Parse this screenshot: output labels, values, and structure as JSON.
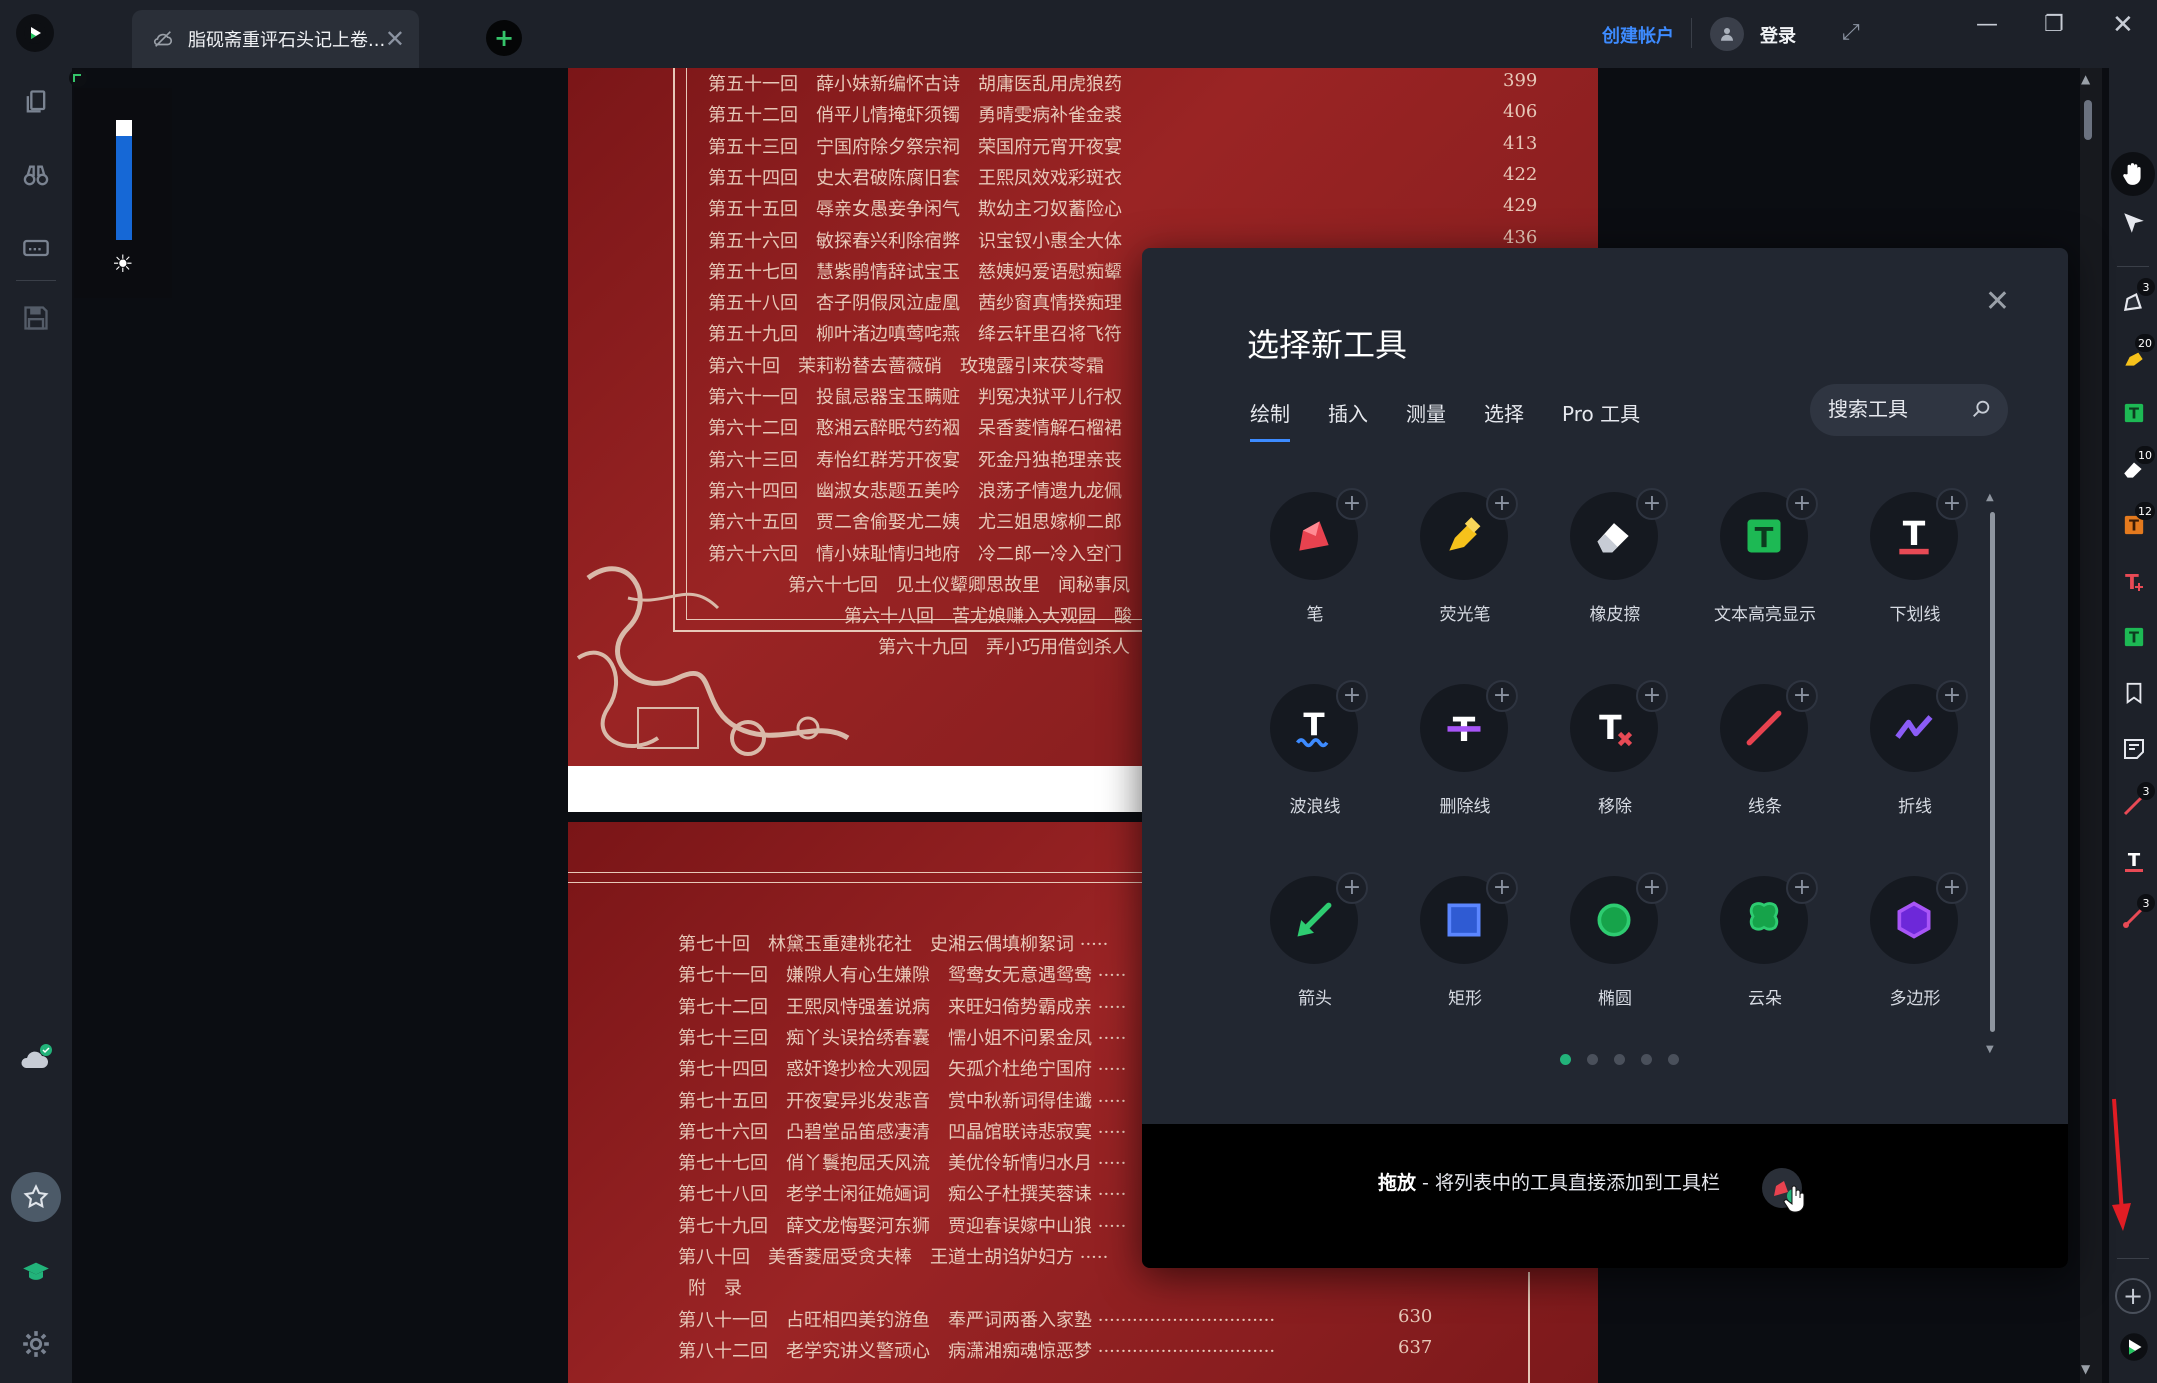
{
  "titlebar": {
    "tab_title": "脂砚斋重评石头记上卷...",
    "create_account": "创建帐户",
    "login": "登录"
  },
  "colors": {
    "accent": "#3d8bff",
    "green": "#22b37a",
    "page_red": "#8b1e1e"
  },
  "page1_lines": [
    {
      "text": "第五十一回　薛小妹新编怀古诗　胡庸医乱用虎狼药",
      "num": "399"
    },
    {
      "text": "第五十二回　俏平儿情掩虾须镯　勇晴雯病补雀金裘",
      "num": "406"
    },
    {
      "text": "第五十三回　宁国府除夕祭宗祠　荣国府元宵开夜宴",
      "num": "413"
    },
    {
      "text": "第五十四回　史太君破陈腐旧套　王熙凤效戏彩斑衣",
      "num": "422"
    },
    {
      "text": "第五十五回　辱亲女愚妾争闲气　欺幼主刁奴蓄险心",
      "num": "429"
    },
    {
      "text": "第五十六回　敏探春兴利除宿弊　识宝钗小惠全大体",
      "num": "436"
    },
    {
      "text": "第五十七回　慧紫鹃情辞试宝玉　慈姨妈爱语慰痴颦",
      "num": ""
    },
    {
      "text": "第五十八回　杏子阴假凤泣虚凰　茜纱窗真情揆痴理",
      "num": ""
    },
    {
      "text": "第五十九回　柳叶渚边嗔莺咤燕　绛云轩里召将飞符",
      "num": ""
    },
    {
      "text": "第六十回　茉莉粉替去蔷薇硝　玫瑰露引来茯苓霜",
      "num": ""
    },
    {
      "text": "第六十一回　投鼠忌器宝玉瞒赃　判冤决狱平儿行权",
      "num": ""
    },
    {
      "text": "第六十二回　憨湘云醉眠芍药裀　呆香菱情解石榴裙",
      "num": ""
    },
    {
      "text": "第六十三回　寿怡红群芳开夜宴　死金丹独艳理亲丧",
      "num": ""
    },
    {
      "text": "第六十四回　幽淑女悲题五美吟　浪荡子情遗九龙佩",
      "num": ""
    },
    {
      "text": "第六十五回　贾二舍偷娶尤二姨　尤三姐思嫁柳二郎",
      "num": ""
    },
    {
      "text": "第六十六回　情小妹耻情归地府　冷二郎一冷入空门",
      "num": ""
    },
    {
      "text": "第六十七回　见土仪颦卿思故里　闻秘事凤",
      "num": ""
    },
    {
      "text": "第六十八回　苦尤娘赚入大观园　酸",
      "num": ""
    },
    {
      "text": "第六十九回　弄小巧用借剑杀人",
      "num": ""
    }
  ],
  "page2_lines": [
    {
      "text": "第七十回　林黛玉重建桃花社　史湘云偶填柳絮词 ·····",
      "num": ""
    },
    {
      "text": "第七十一回　嫌隙人有心生嫌隙　鸳鸯女无意遇鸳鸯 ·····",
      "num": ""
    },
    {
      "text": "第七十二回　王熙凤恃强羞说病　来旺妇倚势霸成亲 ·····",
      "num": ""
    },
    {
      "text": "第七十三回　痴丫头误拾绣春囊　懦小姐不问累金凤 ·····",
      "num": ""
    },
    {
      "text": "第七十四回　惑奸谗抄检大观园　矢孤介杜绝宁国府 ·····",
      "num": ""
    },
    {
      "text": "第七十五回　开夜宴异兆发悲音　赏中秋新词得佳谶 ·····",
      "num": ""
    },
    {
      "text": "第七十六回　凸碧堂品笛感凄清　凹晶馆联诗悲寂寞 ·····",
      "num": ""
    },
    {
      "text": "第七十七回　俏丫鬟抱屈夭风流　美优伶斩情归水月 ·····",
      "num": ""
    },
    {
      "text": "第七十八回　老学士闲征姽婳词　痴公子杜撰芙蓉诔 ·····",
      "num": ""
    },
    {
      "text": "第七十九回　薛文龙悔娶河东狮　贾迎春误嫁中山狼 ·····",
      "num": ""
    },
    {
      "text": "第八十回　美香菱屈受贪夫棒　王道士胡诌妒妇方 ·····",
      "num": ""
    },
    {
      "text": "附　录",
      "num": ""
    },
    {
      "text": "第八十一回　占旺相四美钓游鱼　奉严词两番入家塾 ·······························",
      "num": "630"
    },
    {
      "text": "第八十二回　老学究讲义警顽心　病潇湘痴魂惊恶梦 ·······························",
      "num": "637"
    }
  ],
  "dialog": {
    "title": "选择新工具",
    "tabs": [
      "绘制",
      "插入",
      "测量",
      "选择",
      "Pro 工具"
    ],
    "search_placeholder": "搜索工具",
    "tools": [
      {
        "label": "笔",
        "icon": "pen-icon"
      },
      {
        "label": "荧光笔",
        "icon": "highlighter-icon"
      },
      {
        "label": "橡皮擦",
        "icon": "eraser-icon"
      },
      {
        "label": "文本高亮显示",
        "icon": "text-highlight-icon"
      },
      {
        "label": "下划线",
        "icon": "underline-icon"
      },
      {
        "label": "波浪线",
        "icon": "squiggly-icon"
      },
      {
        "label": "删除线",
        "icon": "strikeout-icon"
      },
      {
        "label": "移除",
        "icon": "remove-text-icon"
      },
      {
        "label": "线条",
        "icon": "line-icon"
      },
      {
        "label": "折线",
        "icon": "polyline-icon"
      },
      {
        "label": "箭头",
        "icon": "arrow-icon"
      },
      {
        "label": "矩形",
        "icon": "rectangle-icon"
      },
      {
        "label": "椭圆",
        "icon": "ellipse-icon"
      },
      {
        "label": "云朵",
        "icon": "cloud-shape-icon"
      },
      {
        "label": "多边形",
        "icon": "polygon-icon"
      }
    ],
    "footer_bold": "拖放",
    "footer_text": " - 将列表中的工具直接添加到工具栏"
  },
  "rightbar_badges": [
    "3",
    "20",
    "10",
    "12",
    "3",
    "3"
  ]
}
